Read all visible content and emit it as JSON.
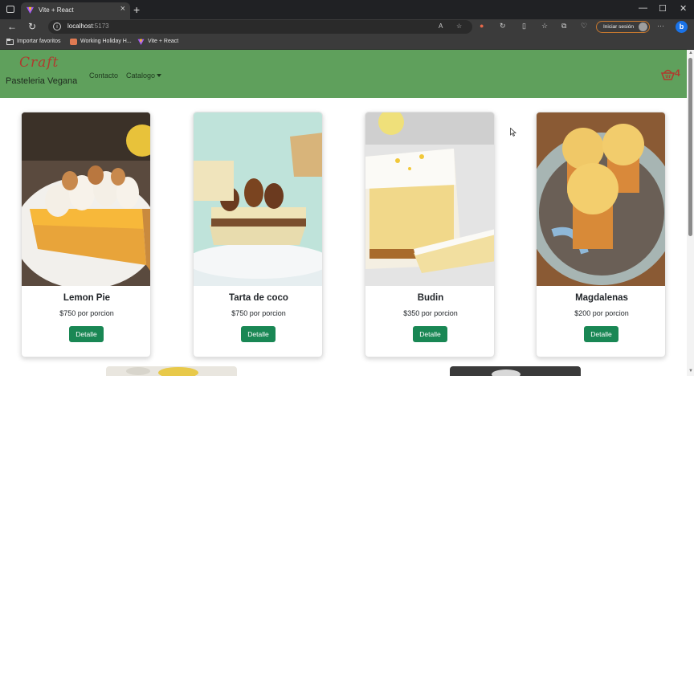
{
  "browser": {
    "tab_title": "Vite + React",
    "url_host": "localhost",
    "url_port": ":5173",
    "signin_label": "Iniciar sesión",
    "bookmarks": [
      "Importar favoritos",
      "Working Holiday H...",
      "Vite + React"
    ]
  },
  "navbar": {
    "brand": "Craft",
    "subtitle": "Pasteleria Vegana",
    "links": [
      "Contacto",
      "Catalogo"
    ],
    "cart_count": "4",
    "bg_color": "#5fa05c"
  },
  "products": [
    {
      "name": "Lemon Pie",
      "price": "$750 por porcion",
      "button": "Detalle"
    },
    {
      "name": "Tarta de coco",
      "price": "$750 por porcion",
      "button": "Detalle"
    },
    {
      "name": "Budin",
      "price": "$350 por porcion",
      "button": "Detalle"
    },
    {
      "name": "Magdalenas",
      "price": "$200 por porcion",
      "button": "Detalle"
    }
  ],
  "colors": {
    "button": "#198754",
    "brand_text": "#b03a2e"
  }
}
